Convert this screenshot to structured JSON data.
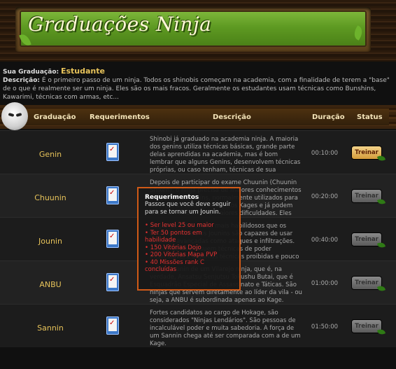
{
  "banner": {
    "title": "Graduações Ninja"
  },
  "info": {
    "graduation_label": "Sua Graduação:",
    "graduation_value": "Estudante",
    "description_label": "Descrição:",
    "description_text": "É o primeiro passo de um ninja. Todos os shinobis começam na academia, com a finalidade de terem a \"base\" de o que é realmente ser um ninja. Eles são os mais fracos. Geralmente os estudantes usam técnicas como Bunshins, Kawarimi, técnicas com armas, etc..."
  },
  "table": {
    "headers": [
      "Graduação",
      "Requerimentos",
      "Descrição",
      "Duração",
      "Status"
    ],
    "rows": [
      {
        "name": "Genin",
        "description": "Shinobi já graduado na academia ninja. A maioria dos genins utiliza técnicas básicas, grande parte delas aprendidas na academia, mas é bom lembrar que alguns Genins, desenvolvem técnicas próprias, ou caso tenham, técnicas de sua linhagem sanguínea avançada.",
        "duration": "00:10:00",
        "status": "Treinar",
        "enabled": true
      },
      {
        "name": "Chuunin",
        "description": "Depois de participar do exame Chuunin (Chuunin Shiken), o ninja precisa de maiores conhecimentos do que os Chuunins, normalmente utilizados para serviços de inteligência pelos Kages e já podem atuar em missões de maiores dificuldades. Eles podem ser líderes de grupo.",
        "duration": "00:20:00",
        "status": "Treinar",
        "enabled": false
      },
      {
        "name": "Jounin",
        "description": "Ninjas de elite, muito mais habilidosos que os Chuunins. Todos os Jounins são capazes de usar técnicas avançadas como ataques e infiltrações. Alguns deles possuem técnicas de poder incalculável e algumas técnicas proibidas e pouco conhecidas.",
        "duration": "00:40:00",
        "status": "Treinar",
        "enabled": false
      },
      {
        "name": "ANBU",
        "description": "A Elite Jounin de um Vilarejo ninja, que é, na verdade, Ansatsu Senjutsu Tokushu Butai, que é Esquadrão Especial de Assassinato e Táticas. São ninjas que servem diretamente ao líder da vila - ou seja, a ANBU é subordinada apenas ao Kage. Cumprem ordens de assassinato, proteção de seu líder e missões que não admitem falhas.",
        "duration": "01:00:00",
        "status": "Treinar",
        "enabled": false
      },
      {
        "name": "Sannin",
        "description": "Fortes candidatos ao cargo de Hokage, são considerados \"Ninjas Lendários\". São pessoas de incalculável poder e muita sabedoria. A força de um Sannin chega até ser comparada com a de um Kage.",
        "duration": "01:50:00",
        "status": "Treinar",
        "enabled": false
      }
    ]
  },
  "tooltip": {
    "title": "Requerimentos",
    "subtitle": "Passos que você deve seguir para se tornar um Jounin.",
    "items": [
      "• Ser level 25 ou maior",
      "• Ter 50 pontos em habilidade",
      "• 150 Vitórias Dojo",
      "• 200 Vitórias Mapa PVP",
      "• 40 Missões rank C concluídas"
    ]
  },
  "colors": {
    "accent": "#e7c35a",
    "tooltip_border": "#d05a17",
    "requirement_text": "#e53030",
    "banner_green": "#6aa82c"
  },
  "icons": {
    "header_mask": "ninja-mask-icon",
    "requirement": "checklist-icon"
  }
}
